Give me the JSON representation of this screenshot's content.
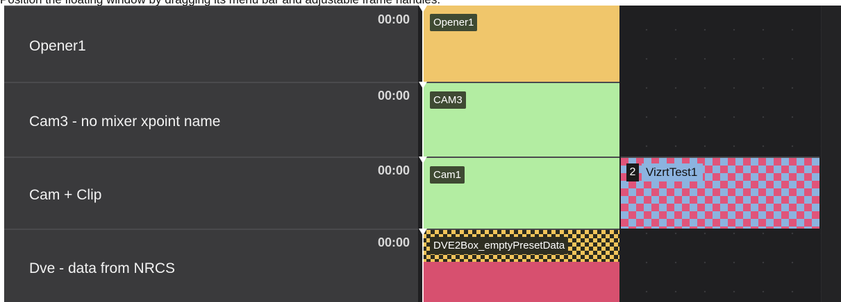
{
  "caption": "Position the floating window by dragging its menu bar and adjustable frame handles.",
  "colors": {
    "opener_clip": "#f0c66b",
    "cam_clip": "#b3eda2",
    "dve_bottom": "#d7506f",
    "checker_pink": "#e0547a",
    "checker_blue": "#8cb3df",
    "checker_gold": "#f2c45a"
  },
  "rows": [
    {
      "label": "Opener1",
      "time": "00:00",
      "clip_tag": "Opener1"
    },
    {
      "label": "Cam3 - no mixer xpoint name",
      "time": "00:00",
      "clip_tag": "CAM3"
    },
    {
      "label": "Cam + Clip",
      "time": "00:00",
      "clip_tag": "Cam1",
      "secondary_clip": {
        "number": "2",
        "label": "VizrtTest1"
      }
    },
    {
      "label": "Dve - data from NRCS",
      "time": "00:00",
      "clip_tag": "DVE2Box_emptyPresetData"
    }
  ]
}
